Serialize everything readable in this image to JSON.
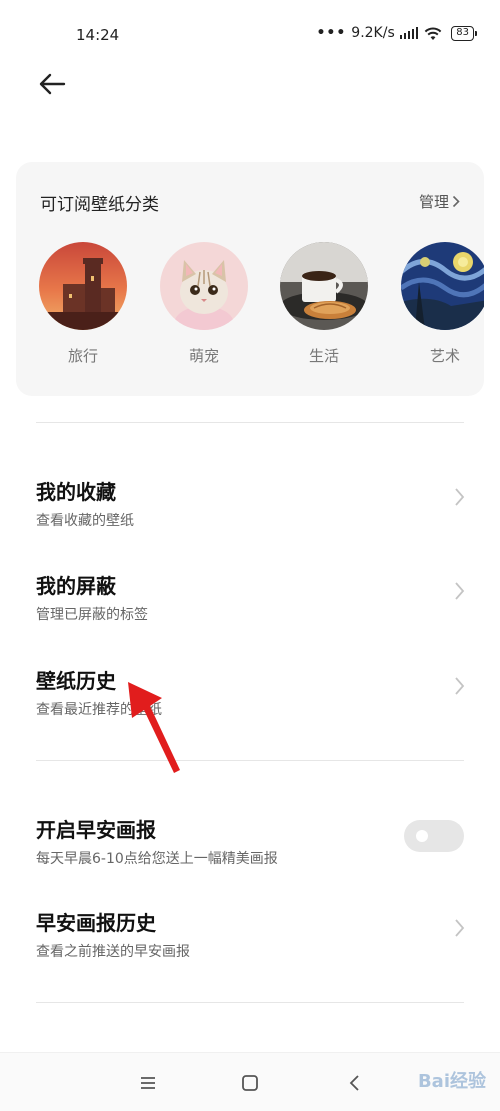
{
  "status": {
    "time": "14:24",
    "dots": "•••",
    "speed": "9.2K/s",
    "battery": "83"
  },
  "card": {
    "title": "可订阅壁纸分类",
    "manage_label": "管理",
    "categories": [
      {
        "label": "旅行",
        "image": "castle-sunset"
      },
      {
        "label": "萌宠",
        "image": "kitten"
      },
      {
        "label": "生活",
        "image": "coffee-croissant"
      },
      {
        "label": "艺术",
        "image": "starry-night"
      }
    ]
  },
  "items": [
    {
      "title": "我的收藏",
      "subtitle": "查看收藏的壁纸"
    },
    {
      "title": "我的屏蔽",
      "subtitle": "管理已屏蔽的标签"
    },
    {
      "title": "壁纸历史",
      "subtitle": "查看最近推荐的壁纸"
    }
  ],
  "morning": {
    "toggle_title": "开启早安画报",
    "toggle_subtitle": "每天早晨6-10点给您送上一幅精美画报",
    "toggle_on": false,
    "history_title": "早安画报历史",
    "history_subtitle": "查看之前推送的早安画报"
  },
  "watermark": "Bai经验",
  "colors": {
    "card_bg": "#f6f6f6",
    "pointer": "#e11d1d",
    "toggle_off": "#e6e6e6"
  }
}
